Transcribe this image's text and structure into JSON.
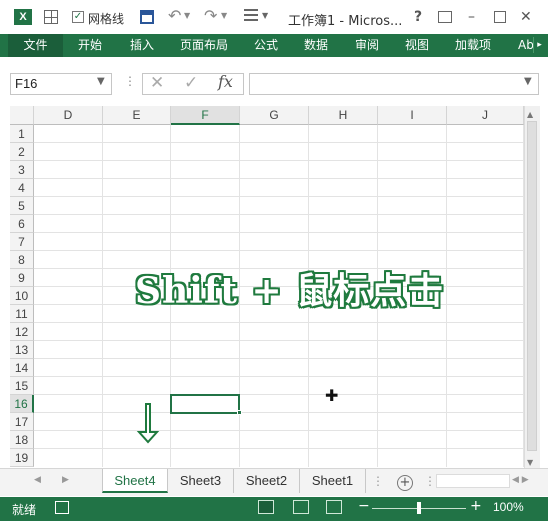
{
  "titlebar": {
    "app_icon": "X",
    "gridlines_label": "网格线",
    "title": "工作簿1 - Micros...",
    "help": "?",
    "restore": "⧉",
    "minimize": "–",
    "close": "✕"
  },
  "ribbon": {
    "tabs": [
      "文件",
      "开始",
      "插入",
      "页面布局",
      "公式",
      "数据",
      "审阅",
      "视图",
      "加载项",
      "Ab"
    ]
  },
  "formula_bar": {
    "name_box": "F16",
    "formula": ""
  },
  "grid": {
    "columns": [
      "D",
      "E",
      "F",
      "G",
      "H",
      "I",
      "J"
    ],
    "active_column": "F",
    "rows": [
      "1",
      "2",
      "3",
      "4",
      "5",
      "6",
      "7",
      "8",
      "9",
      "10",
      "11",
      "12",
      "13",
      "14",
      "15",
      "16",
      "17",
      "18",
      "19"
    ],
    "active_row": "16"
  },
  "overlay": {
    "text": "Shift + 鼠标点击",
    "cursor": "✚",
    "accent_color": "#1f7a3e"
  },
  "sheets": {
    "tabs": [
      "Sheet4",
      "Sheet3",
      "Sheet2",
      "Sheet1"
    ],
    "active": "Sheet4",
    "add": "+"
  },
  "statusbar": {
    "status": "就绪",
    "zoom_minus": "−",
    "zoom_plus": "+",
    "zoom": "100%"
  },
  "colors": {
    "brand": "#217346"
  }
}
